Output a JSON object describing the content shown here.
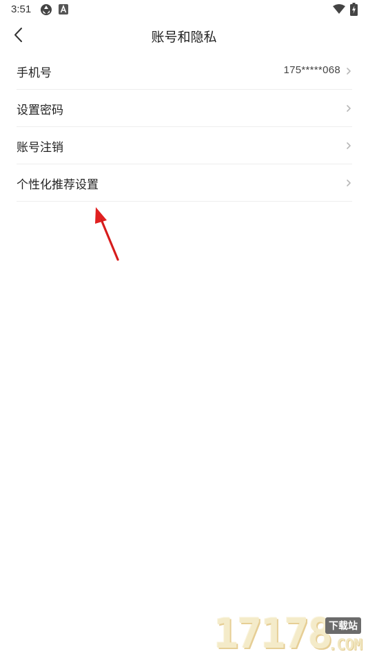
{
  "status_bar": {
    "time": "3:51",
    "icons_left": [
      "aperture-icon",
      "a-badge-icon"
    ],
    "icons_right": [
      "wifi-icon",
      "battery-charging-icon"
    ]
  },
  "header": {
    "back_icon": "chevron-left-icon",
    "title": "账号和隐私"
  },
  "rows": [
    {
      "label": "手机号",
      "value": "175*****068"
    },
    {
      "label": "设置密码",
      "value": ""
    },
    {
      "label": "账号注销",
      "value": ""
    },
    {
      "label": "个性化推荐设置",
      "value": ""
    }
  ],
  "annotation": {
    "color": "#e02020",
    "icon": "red-arrow-icon"
  },
  "watermark": {
    "digits": "17178",
    "badge": "下载站",
    "domain": ".COM"
  },
  "colors": {
    "divider": "#ededed",
    "chevron": "#b8b8b8",
    "text": "#222222"
  }
}
